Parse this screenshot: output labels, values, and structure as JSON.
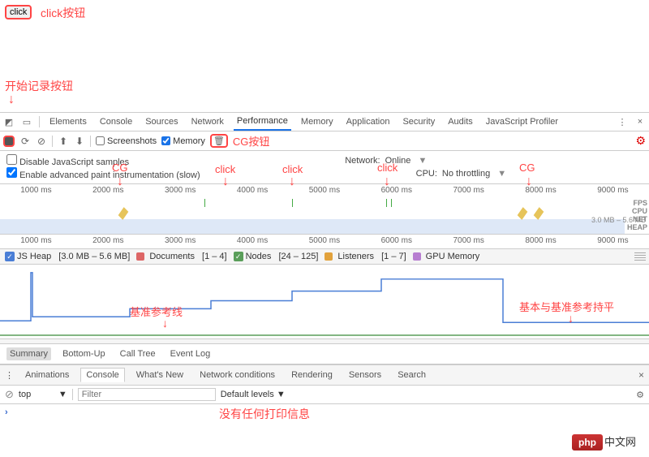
{
  "click_button_label": "click",
  "annotations": {
    "click_button": "click按钮",
    "record_button": "开始记录按钮",
    "cg_button": "CG按钮",
    "cg": "CG",
    "click": "click",
    "baseline": "基准参考线",
    "baseline_equal": "基本与基准参考持平",
    "no_print": "没有任何打印信息"
  },
  "devtools_tabs": [
    "Elements",
    "Console",
    "Sources",
    "Network",
    "Performance",
    "Memory",
    "Application",
    "Security",
    "Audits",
    "JavaScript Profiler"
  ],
  "active_tab": "Performance",
  "toolbar": {
    "screenshots_label": "Screenshots",
    "screenshots_checked": false,
    "memory_label": "Memory",
    "memory_checked": true
  },
  "options": {
    "disable_js_samples": "Disable JavaScript samples",
    "disable_js_checked": false,
    "adv_paint": "Enable advanced paint instrumentation (slow)",
    "adv_paint_checked": true,
    "network_label": "Network:",
    "network_value": "Online",
    "cpu_label": "CPU:",
    "cpu_value": "No throttling"
  },
  "timeline_ticks": [
    "1000 ms",
    "2000 ms",
    "3000 ms",
    "4000 ms",
    "5000 ms",
    "6000 ms",
    "7000 ms",
    "8000 ms",
    "9000 ms"
  ],
  "track_labels": [
    "FPS",
    "CPU",
    "NET",
    "HEAP"
  ],
  "heap_range_label": "3.0 MB – 5.6 MB",
  "legend": {
    "js_heap": {
      "label": "JS Heap",
      "range": "[3.0 MB – 5.6 MB]",
      "color": "#4a7ed6"
    },
    "documents": {
      "label": "Documents",
      "range": "[1 – 4]",
      "color": "#d66"
    },
    "nodes": {
      "label": "Nodes",
      "range": "[24 – 125]",
      "color": "#5a9e5a"
    },
    "listeners": {
      "label": "Listeners",
      "range": "[1 – 7]",
      "color": "#e2a23c"
    },
    "gpu": {
      "label": "GPU Memory",
      "color": "#b77ed1"
    }
  },
  "chart_data": {
    "type": "line",
    "x_unit": "ms",
    "x_range": [
      0,
      9500
    ],
    "series": [
      {
        "name": "JS Heap",
        "unit": "MB",
        "y_range": [
          3.0,
          5.6
        ],
        "points": [
          [
            0,
            3.0
          ],
          [
            500,
            5.6
          ],
          [
            500,
            3.2
          ],
          [
            2000,
            3.2
          ],
          [
            2000,
            3.7
          ],
          [
            3200,
            3.7
          ],
          [
            3200,
            4.2
          ],
          [
            4500,
            4.2
          ],
          [
            4500,
            4.8
          ],
          [
            5800,
            4.8
          ],
          [
            5800,
            5.5
          ],
          [
            7400,
            5.5
          ],
          [
            7400,
            3.0
          ],
          [
            9500,
            3.0
          ]
        ]
      },
      {
        "name": "Nodes",
        "y_range": [
          24,
          125
        ],
        "points": [
          [
            0,
            24
          ],
          [
            9500,
            24
          ]
        ]
      }
    ]
  },
  "summary_tabs": [
    "Summary",
    "Bottom-Up",
    "Call Tree",
    "Event Log"
  ],
  "summary_active": "Summary",
  "drawer_tabs": [
    "Animations",
    "Console",
    "What's New",
    "Network conditions",
    "Rendering",
    "Sensors",
    "Search"
  ],
  "drawer_active": "Console",
  "console": {
    "context": "top",
    "filter_placeholder": "Filter",
    "levels": "Default levels"
  }
}
